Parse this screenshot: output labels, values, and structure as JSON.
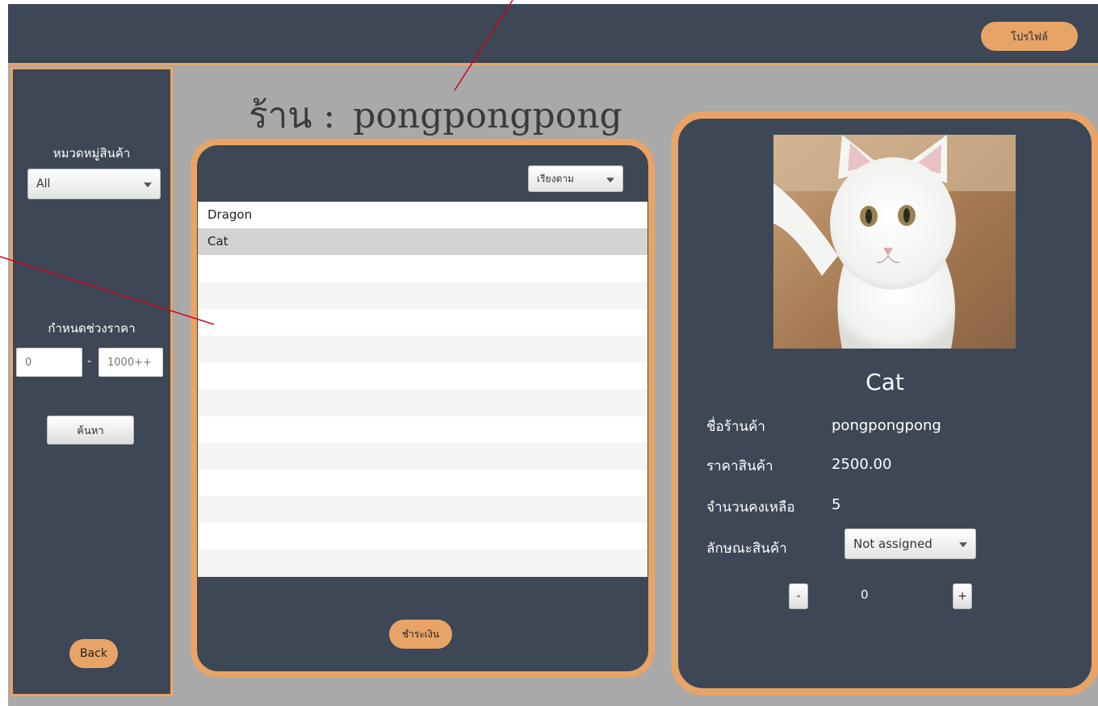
{
  "header": {
    "profile_label": "โปรไฟล์"
  },
  "sidebar": {
    "category_label": "หมวดหมู่สินค้า",
    "category_value": "All",
    "price_range_label": "กำหนดช่วงราคา",
    "price_min_placeholder": "0",
    "price_separator": "-",
    "price_max_placeholder": "1000++",
    "search_label": "ค้นหา",
    "back_label": "Back"
  },
  "shop": {
    "prefix": "ร้าน :",
    "name": "pongpongpong"
  },
  "product_list": {
    "sort_label": "เรียงตาม",
    "items": [
      "Dragon",
      "Cat"
    ],
    "selected_index": 1,
    "pay_label": "ชำระเงิน"
  },
  "detail": {
    "name": "Cat",
    "shop_label": "ชื่อร้านค้า",
    "shop_value": "pongpongpong",
    "price_label": "ราคาสินค้า",
    "price_value": "2500.00",
    "stock_label": "จำนวนคงเหลือ",
    "stock_value": "5",
    "attribute_label": "ลักษณะสินค้า",
    "attribute_value": "Not assigned",
    "decrement_label": "-",
    "quantity": "0",
    "increment_label": "+"
  },
  "colors": {
    "panel": "#3d4755",
    "accent": "#e8a467",
    "background": "#a9a9a9"
  }
}
